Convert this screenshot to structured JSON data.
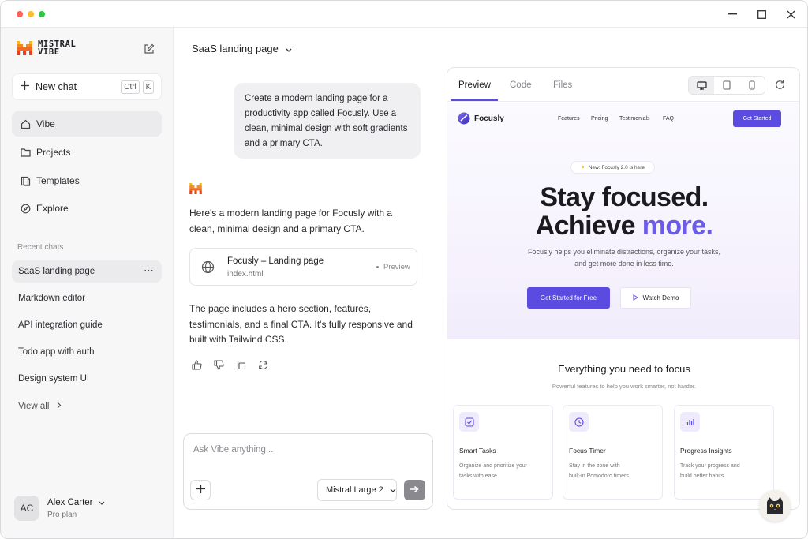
{
  "window": {
    "controls": [
      "minimize-icon",
      "maximize-icon",
      "close-icon"
    ]
  },
  "sidebar": {
    "brand": {
      "line1": "MISTRAL",
      "line2": "VIBE"
    },
    "new_chat": {
      "label": "New chat",
      "shortcut_1": "Ctrl",
      "shortcut_2": "K"
    },
    "nav": [
      {
        "label": "Vibe",
        "icon": "home-icon",
        "active": true
      },
      {
        "label": "Projects",
        "icon": "folder-icon"
      },
      {
        "label": "Templates",
        "icon": "template-icon"
      },
      {
        "label": "Explore",
        "icon": "compass-icon"
      }
    ],
    "recent_title": "Recent chats",
    "recent": [
      {
        "label": "SaaS landing page",
        "active": true,
        "more": "⋯"
      },
      {
        "label": "Markdown editor"
      },
      {
        "label": "API integration guide"
      },
      {
        "label": "Todo app with auth"
      },
      {
        "label": "Design system UI"
      }
    ],
    "view_all": "View all",
    "user": {
      "initials": "AC",
      "name": "Alex Carter",
      "plan": "Pro plan"
    }
  },
  "chat": {
    "title": "SaaS landing page",
    "user_message": "Create a modern landing page for a productivity app called Focusly. Use a clean, minimal design with soft gradients and a primary CTA.",
    "assistant_intro": "Here's a modern landing page for Focusly with a clean, minimal design and a primary CTA.",
    "file_card": {
      "title": "Focusly – Landing page",
      "file": "index.html",
      "action": "Preview"
    },
    "assistant_outro": "The page includes a hero section, features, testimonials, and a final CTA. It's fully responsive and built with Tailwind CSS.",
    "input": {
      "placeholder": "Ask Vibe anything...",
      "model": "Mistral Large 2"
    }
  },
  "preview": {
    "tabs": [
      "Preview",
      "Code",
      "Files"
    ],
    "active_tab": "Preview",
    "devices": [
      "desktop-icon",
      "tablet-icon",
      "phone-icon"
    ],
    "site": {
      "brand": "Focusly",
      "nav": [
        "Features",
        "Pricing",
        "Testimonials",
        "FAQ"
      ],
      "nav_cta": "Get Started",
      "badge": "New: Focusly 2.0 is here",
      "headline_1": "Stay focused.",
      "headline_2a": "Achieve ",
      "headline_2b": "more.",
      "subhead_1": "Focusly helps you eliminate distractions, organize your tasks,",
      "subhead_2": "and get more done in less time.",
      "cta_primary": "Get Started for Free",
      "cta_secondary": "Watch Demo",
      "features_title": "Everything you need to focus",
      "features_sub": "Powerful features to help you work smarter, not harder.",
      "features": [
        {
          "title": "Smart Tasks",
          "line1": "Organize and prioritize your",
          "line2": "tasks with ease.",
          "icon": "check-square-icon"
        },
        {
          "title": "Focus Timer",
          "line1": "Stay in the zone with",
          "line2": "built-in Pomodoro timers.",
          "icon": "clock-icon"
        },
        {
          "title": "Progress Insights",
          "line1": "Track your progress and",
          "line2": "build better habits.",
          "icon": "bar-chart-icon"
        }
      ]
    }
  },
  "colors": {
    "accent": "#5b4be0",
    "brand_orange": "#f08a24",
    "brand_red": "#e5421c"
  }
}
